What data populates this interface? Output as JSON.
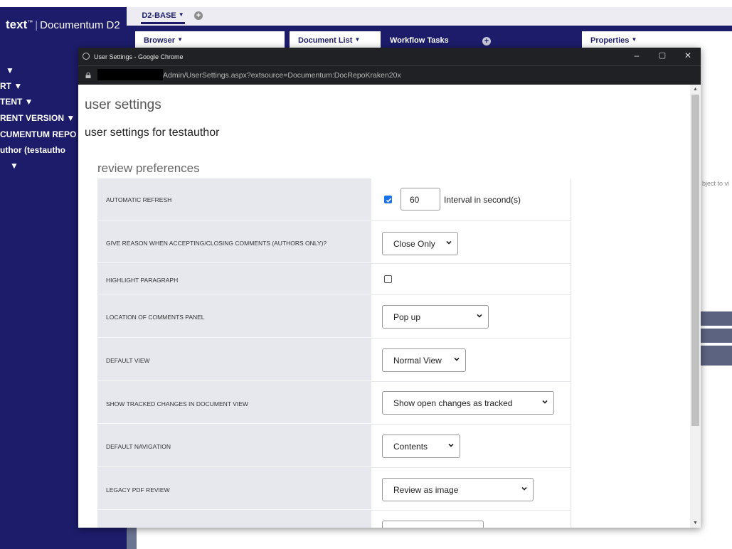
{
  "app": {
    "logo_brand": "text",
    "logo_tm": "™",
    "logo_product": "Documentum D2",
    "top_tab": "D2-BASE",
    "add_symbol": "+",
    "left_menu": [
      {
        "label": "▼"
      },
      {
        "label": "RT ▼"
      },
      {
        "label": "TENT ▼"
      },
      {
        "label": "RENT VERSION ▼"
      },
      {
        "label": "CUMENTUM REPO"
      },
      {
        "label": "uthor (testautho"
      },
      {
        "label": "▼"
      }
    ],
    "workspace_tabs": {
      "browser": "Browser",
      "document_list": "Document List",
      "workflow_tasks": "Workflow Tasks",
      "properties": "Properties"
    },
    "tab_arrow": "▼",
    "hint_text": "bject to vi"
  },
  "window": {
    "title": "User Settings - Google Chrome",
    "url": "Admin/UserSettings.aspx?extsource=Documentum:DocRepoKraken20x",
    "minimize": "–",
    "maximize": "▢",
    "close": "✕"
  },
  "page": {
    "title": "user settings",
    "subtitle": "user settings for testauthor",
    "section": "review preferences"
  },
  "settings": {
    "auto_refresh": {
      "label": "AUTOMATIC REFRESH",
      "checked": true,
      "interval": "60",
      "interval_label": "Interval in second(s)"
    },
    "give_reason": {
      "label": "GIVE REASON WHEN ACCEPTING/CLOSING COMMENTS (AUTHORS ONLY)?",
      "value": "Close Only"
    },
    "highlight": {
      "label": "HIGHLIGHT PARAGRAPH",
      "checked": false
    },
    "comments_location": {
      "label": "LOCATION OF COMMENTS PANEL",
      "value": "Pop up"
    },
    "default_view": {
      "label": "DEFAULT VIEW",
      "value": "Normal View"
    },
    "tracked_changes": {
      "label": "SHOW TRACKED CHANGES IN DOCUMENT VIEW",
      "value": "Show open changes as tracked"
    },
    "default_nav": {
      "label": "DEFAULT NAVIGATION",
      "value": "Contents"
    },
    "legacy_pdf": {
      "label": "LEGACY PDF REVIEW",
      "value": "Review as image"
    }
  },
  "colors": {
    "brand_navy": "#1c1c6b",
    "checkbox_blue": "#1a73e8",
    "label_bg": "#e6e8ed",
    "chrome_dark": "#202124"
  }
}
